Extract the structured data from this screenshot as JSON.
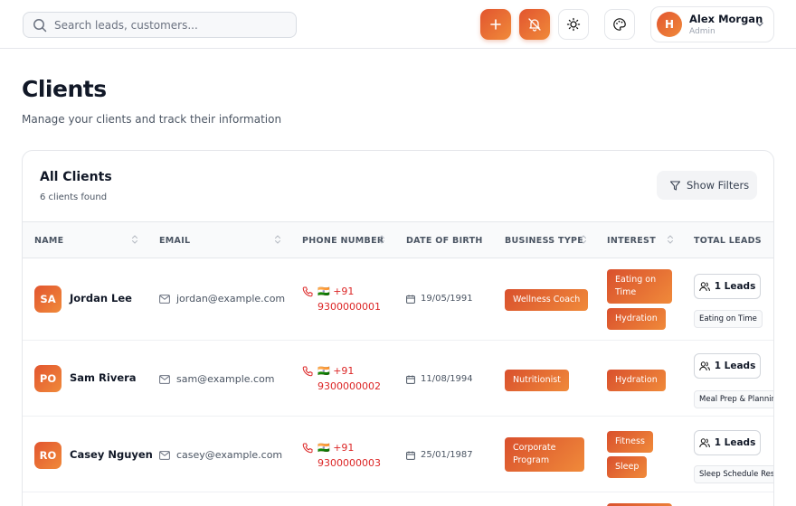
{
  "header": {
    "search_placeholder": "Search leads, customers...",
    "user_initial": "H",
    "user_name": "Alex Morgan",
    "user_role": "Admin"
  },
  "page": {
    "title": "Clients",
    "subtitle": "Manage your clients and track their information"
  },
  "card": {
    "title": "All Clients",
    "count_text": "6 clients found",
    "filters_label": "Show Filters"
  },
  "columns": [
    "NAME",
    "EMAIL",
    "PHONE NUMBER",
    "DATE OF BIRTH",
    "BUSINESS TYPE",
    "INTEREST",
    "TOTAL LEADS"
  ],
  "rows": [
    {
      "initials": "SA",
      "name": "Jordan Lee",
      "email": "jordan@example.com",
      "phone_line1": "🇮🇳 +91",
      "phone_line2": "9300000001",
      "dob": "19/05/1991",
      "business_line1": "Wellness Coach",
      "business_line2": "",
      "interest1": "Eating on",
      "interest1b": "Time",
      "interest2": "Hydration",
      "leads": "1 Leads",
      "lead_tag": "Eating on Time"
    },
    {
      "initials": "PO",
      "name": "Sam Rivera",
      "email": "sam@example.com",
      "phone_line1": "🇮🇳 +91",
      "phone_line2": "9300000002",
      "dob": "11/08/1994",
      "business_line1": "Nutritionist",
      "business_line2": "",
      "interest1": "Hydration",
      "leads": "1 Leads",
      "lead_tag": "Meal Prep & Planning"
    },
    {
      "initials": "RO",
      "name": "Casey Nguyen",
      "email": "casey@example.com",
      "phone_line1": "🇮🇳 +91",
      "phone_line2": "9300000003",
      "dob": "25/01/1987",
      "business_line1": "Corporate",
      "business_line2": "Program",
      "interest1": "Fitness",
      "interest2": "Sleep",
      "leads": "1 Leads",
      "lead_tag": "Sleep Schedule Reset"
    }
  ],
  "colors": {
    "accent": "#e2552f",
    "accent2": "#f08a3a",
    "phone": "#dc2626"
  },
  "icons": [
    "search-icon",
    "plus-icon",
    "bell-off-icon",
    "sun-icon",
    "palette-icon",
    "chevron-down-icon",
    "filter-icon",
    "sort-icon",
    "mail-icon",
    "phone-icon",
    "calendar-icon",
    "users-icon"
  ]
}
